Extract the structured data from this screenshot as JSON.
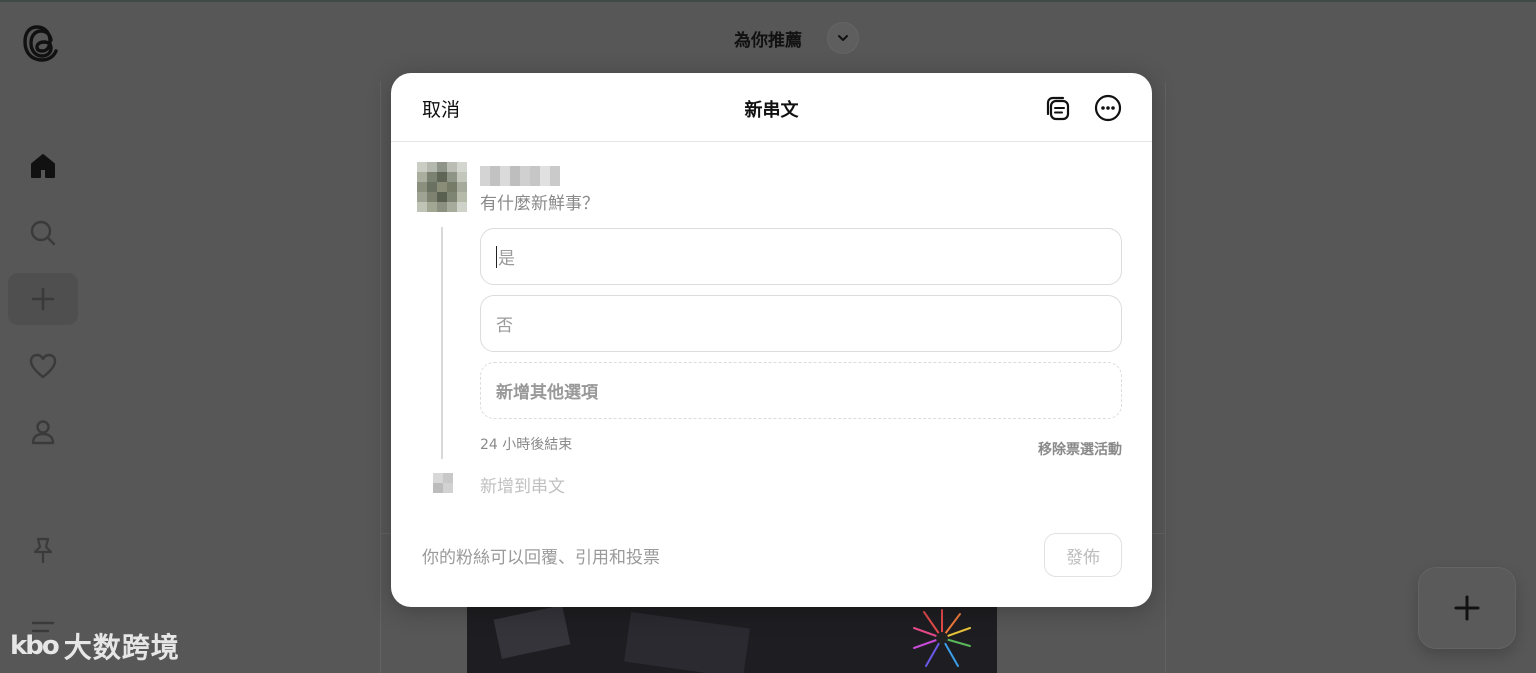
{
  "feed": {
    "title": "為你推薦"
  },
  "sidebar": {
    "items": [
      {
        "name": "home",
        "icon": "home-icon"
      },
      {
        "name": "search",
        "icon": "search-icon"
      },
      {
        "name": "create",
        "icon": "plus-icon"
      },
      {
        "name": "activity",
        "icon": "heart-icon"
      },
      {
        "name": "profile",
        "icon": "person-icon"
      },
      {
        "name": "pinned",
        "icon": "pin-icon"
      },
      {
        "name": "menu",
        "icon": "menu-icon"
      }
    ]
  },
  "modal": {
    "cancel_label": "取消",
    "title": "新串文",
    "prompt_placeholder": "有什麼新鮮事？",
    "poll": {
      "options": [
        {
          "placeholder": "是",
          "focused": true
        },
        {
          "placeholder": "否",
          "focused": false
        }
      ],
      "add_option_label": "新增其他選項",
      "duration_label": "24 小時後結束",
      "remove_label": "移除票選活動"
    },
    "add_to_thread_label": "新增到串文",
    "reply_setting_label": "你的粉絲可以回覆、引用和投票",
    "post_label": "發佈"
  },
  "watermark": {
    "logo": "kbo",
    "text": "大数跨境"
  },
  "colors": {
    "overlay": "#575757",
    "modal_bg": "#ffffff",
    "placeholder": "#9a9a9a",
    "border": "#dcdcdc"
  }
}
